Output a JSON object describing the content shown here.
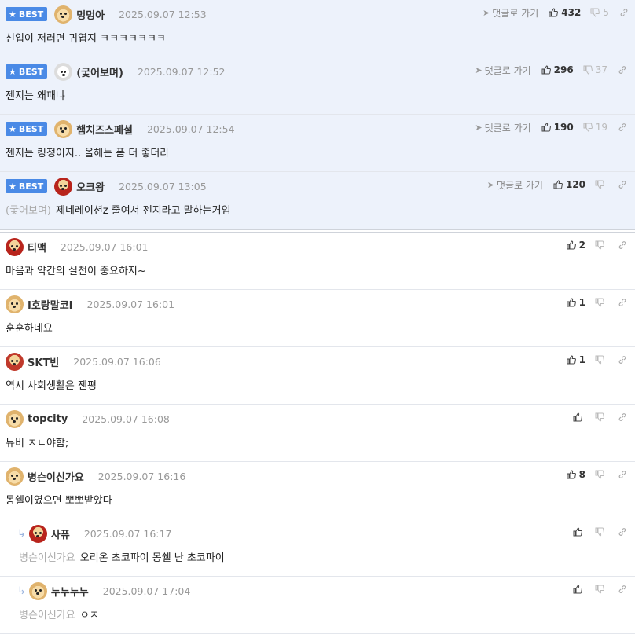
{
  "best_label": "BEST",
  "goto_label": "댓글로 가기",
  "colors": {
    "best_bg": "#edf2fb",
    "badge": "#4a8ae6",
    "muted": "#999999"
  },
  "best_comments": [
    {
      "nick": "멍멍아",
      "date": "2025.09.07 12:53",
      "text": "신입이 저러면 귀엽지 ㅋㅋㅋㅋㅋㅋㅋ",
      "ref": "",
      "up": "432",
      "down": "5",
      "avatar": "puppy-avatar"
    },
    {
      "nick": "(궃어보며)",
      "date": "2025.09.07 12:52",
      "text": "젠지는 왜패냐",
      "ref": "",
      "up": "296",
      "down": "37",
      "avatar": "white-dog-avatar"
    },
    {
      "nick": "햄치즈스페셜",
      "date": "2025.09.07 12:54",
      "text": "젠지는 킹정이지.. 올해는 폼 더 좋더라",
      "ref": "",
      "up": "190",
      "down": "19",
      "avatar": "puppy-avatar"
    },
    {
      "nick": "오크왕",
      "date": "2025.09.07 13:05",
      "text": "제네레이션z 줄여서 젠지라고 말하는거임",
      "ref": "(궃어보며)",
      "up": "120",
      "down": "",
      "avatar": "pooh-avatar"
    }
  ],
  "comments": [
    {
      "nick": "티맥",
      "date": "2025.09.07 16:01",
      "text": "마음과 약간의 실천이 중요하지~",
      "ref": "",
      "up": "2",
      "reply": false,
      "avatar": "pooh-avatar"
    },
    {
      "nick": "I호랑말코I",
      "date": "2025.09.07 16:01",
      "text": "훈훈하네요",
      "ref": "",
      "up": "1",
      "reply": false,
      "avatar": "puppy-avatar"
    },
    {
      "nick": "SKT빈",
      "date": "2025.09.07 16:06",
      "text": "역시 사회생활은 젠평",
      "ref": "",
      "up": "1",
      "reply": false,
      "avatar": "skt-avatar"
    },
    {
      "nick": "topcity",
      "date": "2025.09.07 16:08",
      "text": "뉴비 ㅈㄴ야함;",
      "ref": "",
      "up": "",
      "reply": false,
      "avatar": "puppy-avatar"
    },
    {
      "nick": "병슨이신가요",
      "date": "2025.09.07 16:16",
      "text": "몽쉘이였으면 뽀뽀받았다",
      "ref": "",
      "up": "8",
      "reply": false,
      "avatar": "puppy-avatar"
    },
    {
      "nick": "사퓨",
      "date": "2025.09.07 16:17",
      "text": "오리온 초코파이 몽쉘 난 초코파이",
      "ref": "병슨이신가요",
      "up": "",
      "reply": true,
      "avatar": "pooh-avatar"
    },
    {
      "nick": "누누누누",
      "date": "2025.09.07 17:04",
      "text": "ㅇㅈ",
      "ref": "병슨이신가요",
      "up": "",
      "reply": true,
      "avatar": "puppy-avatar"
    }
  ]
}
